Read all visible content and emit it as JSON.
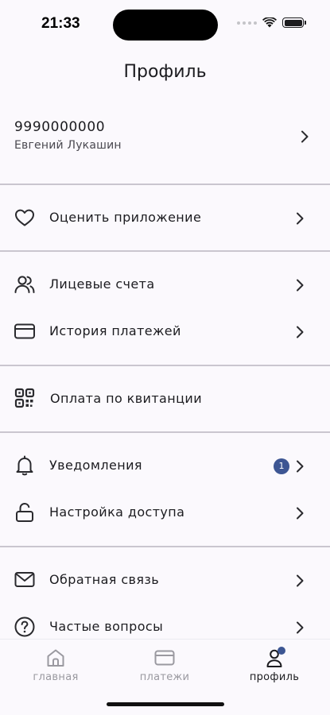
{
  "status_bar": {
    "time": "21:33"
  },
  "header": {
    "title": "Профиль"
  },
  "profile": {
    "phone": "9990000000",
    "name": "Евгений Лукашин"
  },
  "menu": {
    "rate_app": "Оценить приложение",
    "accounts": "Лицевые счета",
    "payment_history": "История платежей",
    "pay_by_receipt": "Оплата по квитанции",
    "notifications": "Уведомления",
    "notifications_badge": "1",
    "access_settings": "Настройка доступа",
    "feedback": "Обратная связь",
    "faq": "Частые вопросы"
  },
  "tab_bar": {
    "items": [
      {
        "label": "главная",
        "icon": "home-icon",
        "active": false
      },
      {
        "label": "платежи",
        "icon": "card-icon",
        "active": false
      },
      {
        "label": "профиль",
        "icon": "person-icon",
        "active": true
      }
    ]
  },
  "colors": {
    "accent": "#3d5693",
    "background": "#fbf9fd",
    "divider": "#cac6cf"
  }
}
